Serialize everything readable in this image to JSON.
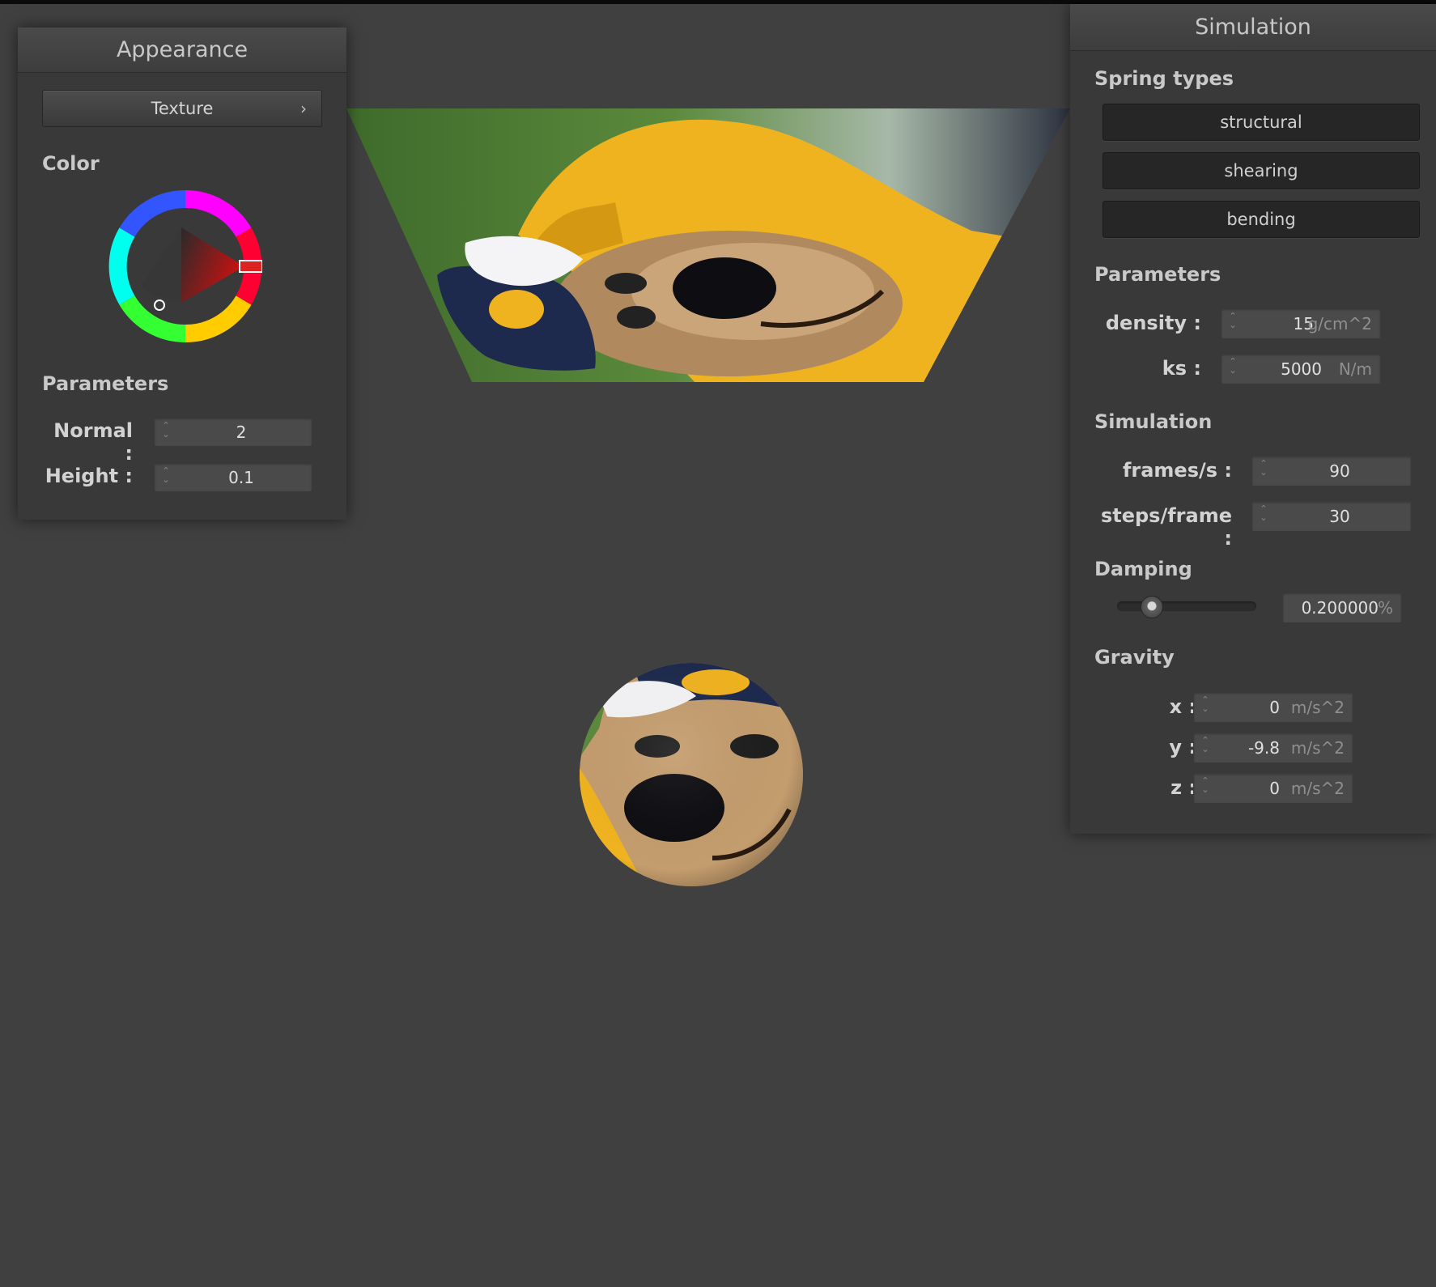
{
  "appearance": {
    "title": "Appearance",
    "texture_button": "Texture",
    "color_label": "Color",
    "parameters_label": "Parameters",
    "normal_label": "Normal :",
    "normal_value": "2",
    "height_label": "Height :",
    "height_value": "0.1",
    "selected_color": "#cc1111"
  },
  "simulation": {
    "title": "Simulation",
    "spring_types_label": "Spring types",
    "spring_types": [
      "structural",
      "shearing",
      "bending"
    ],
    "parameters_label": "Parameters",
    "density_label": "density :",
    "density_value": "15",
    "density_unit": "g/cm^2",
    "ks_label": "ks :",
    "ks_value": "5000",
    "ks_unit": "N/m",
    "simulation_label": "Simulation",
    "fps_label": "frames/s :",
    "fps_value": "90",
    "steps_label": "steps/frame :",
    "steps_value": "30",
    "damping_label": "Damping",
    "damping_value": "0.200000",
    "damping_unit": "%",
    "damping_level": 0.2,
    "gravity_label": "Gravity",
    "gx_label": "x :",
    "gx_value": "0",
    "gy_label": "y :",
    "gy_value": "-9.8",
    "gz_label": "z :",
    "gz_value": "0",
    "gravity_unit": "m/s^2"
  },
  "colors": {
    "background": "#404040",
    "panel": "#393939",
    "mascot_yellow": "#f2b21c",
    "mascot_navy": "#1d2a4d",
    "grass_green": "#4f7d35"
  }
}
